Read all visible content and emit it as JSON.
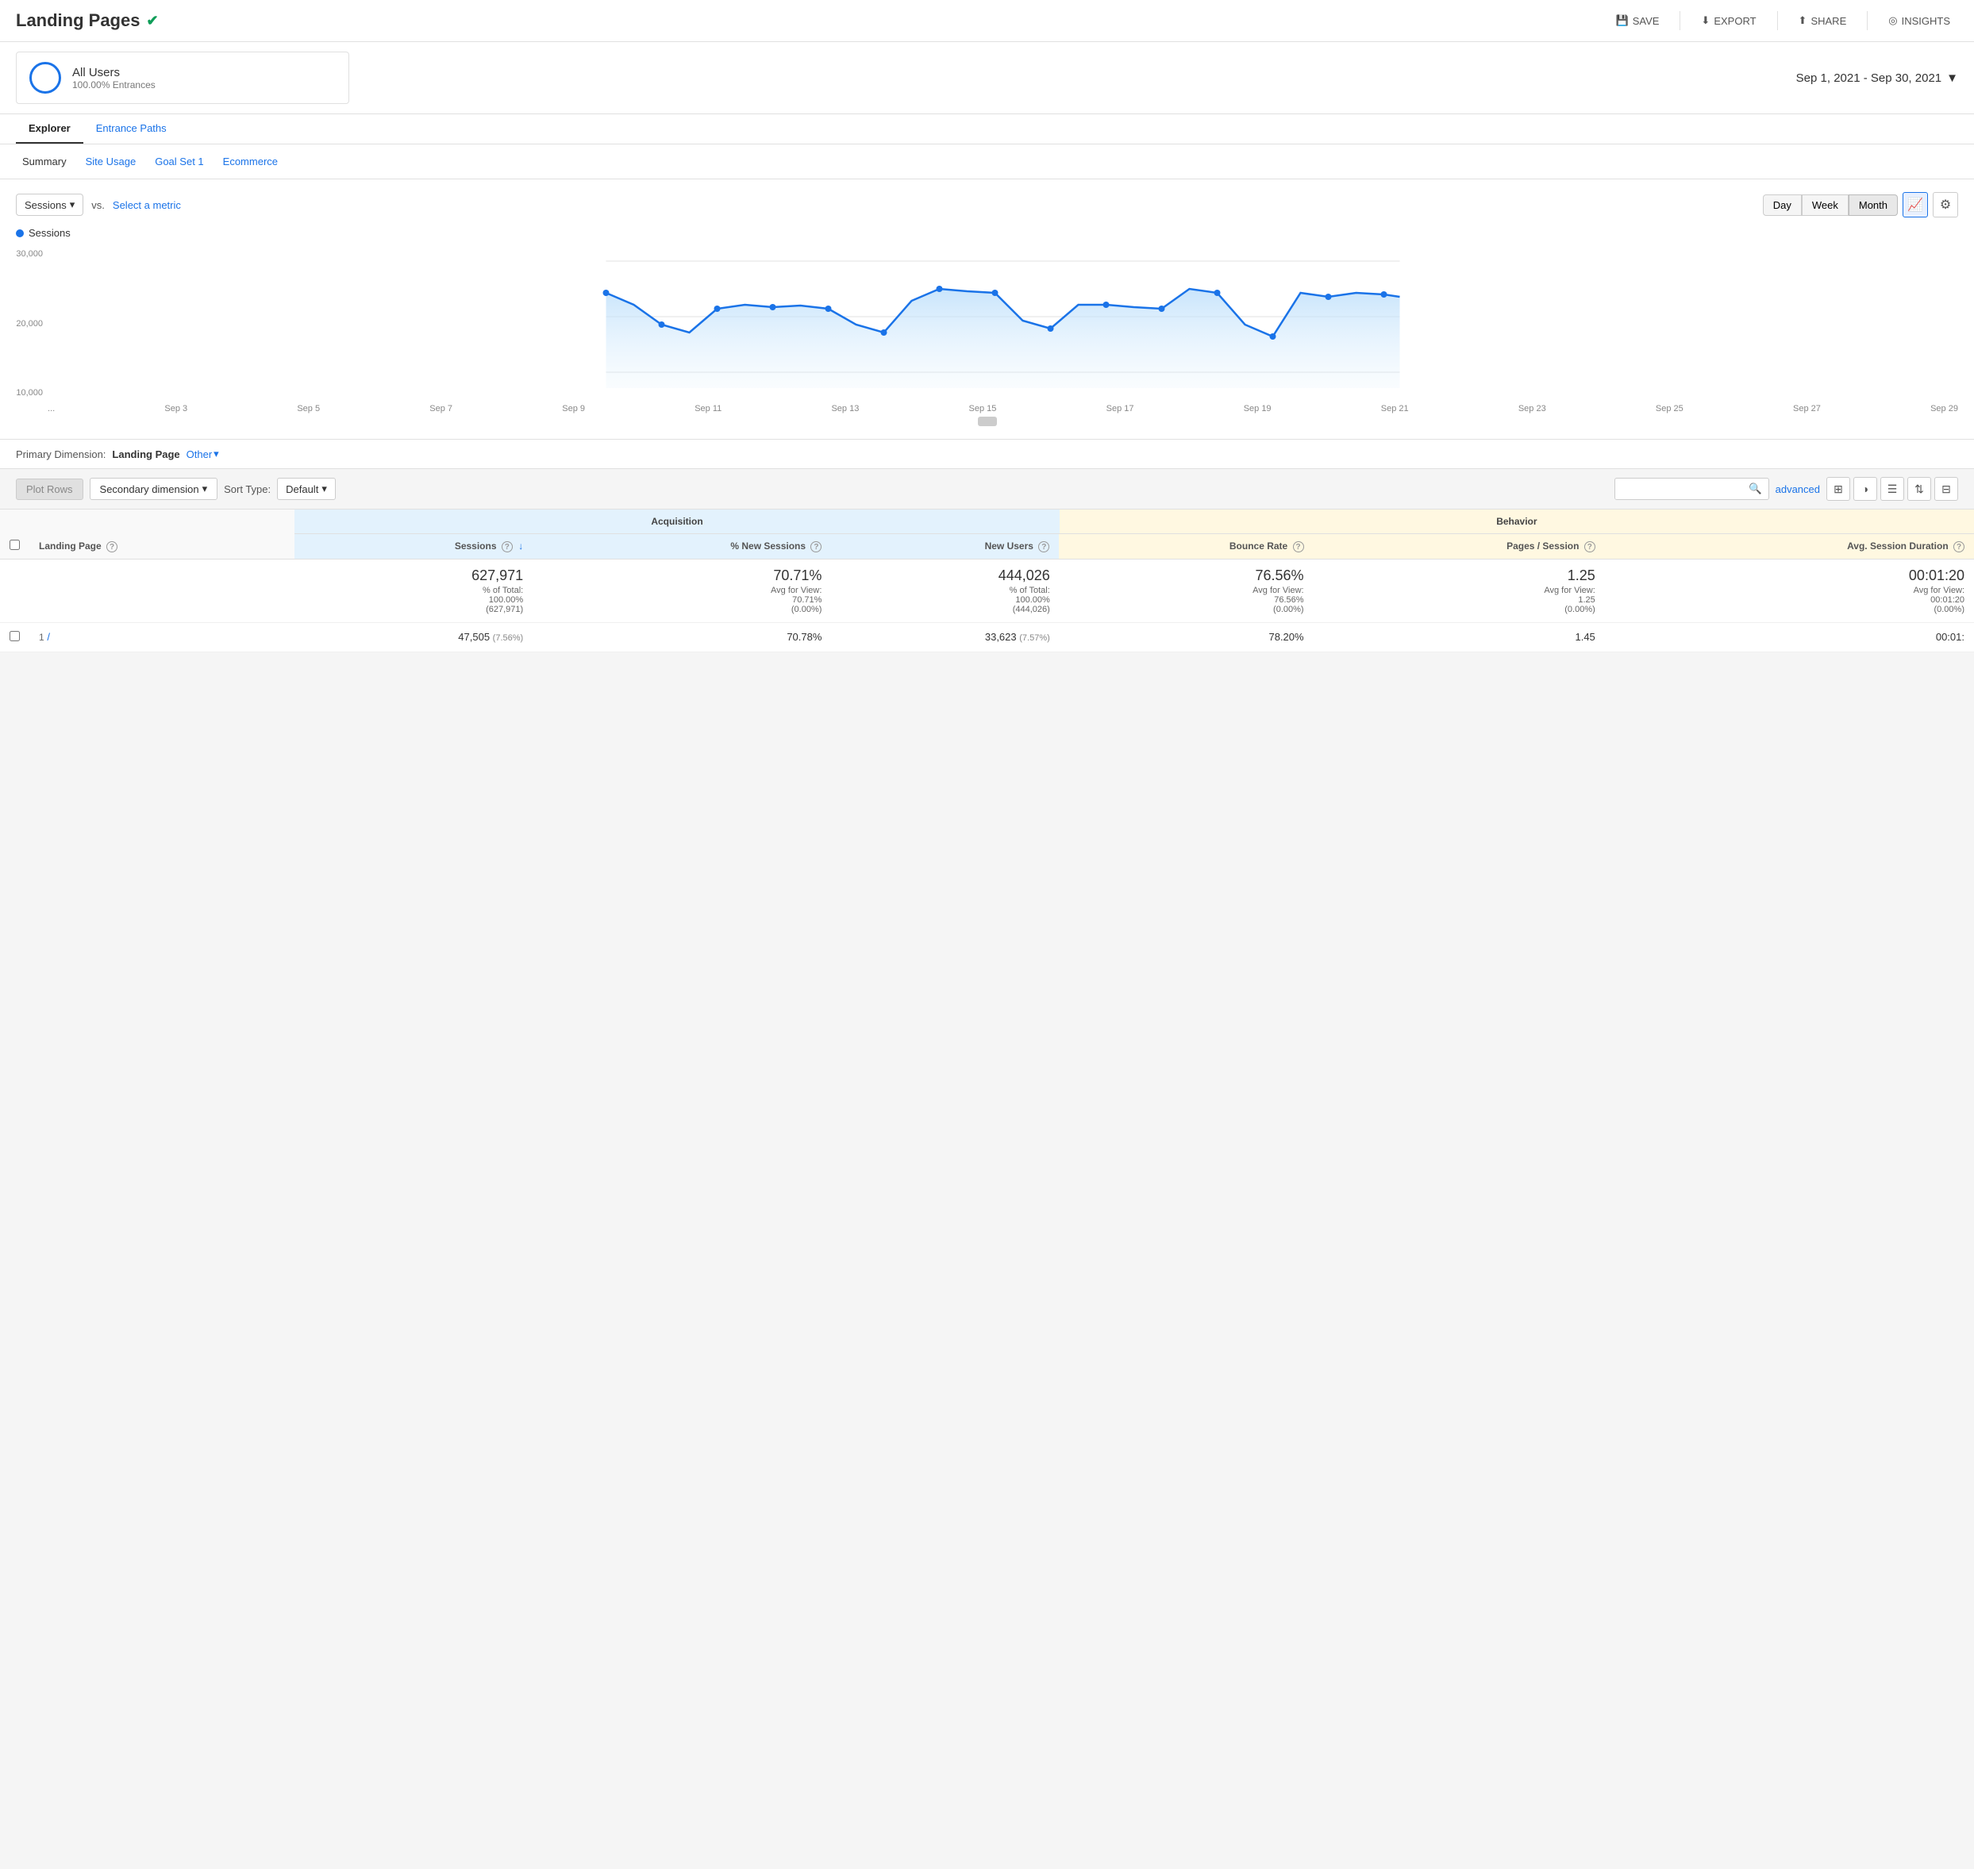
{
  "page": {
    "title": "Landing Pages",
    "verified": true
  },
  "header": {
    "save_label": "SAVE",
    "export_label": "EXPORT",
    "share_label": "SHARE",
    "insights_label": "INSIGHTS"
  },
  "segment": {
    "name": "All Users",
    "subtitle": "100.00% Entrances"
  },
  "date_range": {
    "label": "Sep 1, 2021 - Sep 30, 2021"
  },
  "tabs": {
    "main": [
      {
        "label": "Explorer",
        "active": true
      },
      {
        "label": "Entrance Paths",
        "active": false
      }
    ],
    "sub": [
      {
        "label": "Summary",
        "active": true
      },
      {
        "label": "Site Usage",
        "active": false
      },
      {
        "label": "Goal Set 1",
        "active": false
      },
      {
        "label": "Ecommerce",
        "active": false
      }
    ]
  },
  "chart": {
    "metric_label": "Sessions",
    "vs_label": "vs.",
    "select_metric_label": "Select a metric",
    "legend_label": "Sessions",
    "y_labels": [
      "30,000",
      "20,000",
      "10,000"
    ],
    "x_labels": [
      "...",
      "Sep 3",
      "Sep 5",
      "Sep 7",
      "Sep 9",
      "Sep 11",
      "Sep 13",
      "Sep 15",
      "Sep 17",
      "Sep 19",
      "Sep 21",
      "Sep 23",
      "Sep 25",
      "Sep 27",
      "Sep 29"
    ],
    "period_buttons": [
      "Day",
      "Week",
      "Month"
    ],
    "active_period": "Month"
  },
  "dimension": {
    "label": "Primary Dimension:",
    "value": "Landing Page",
    "other_label": "Other"
  },
  "table_controls": {
    "plot_rows_label": "Plot Rows",
    "secondary_dim_label": "Secondary dimension",
    "sort_type_label": "Sort Type:",
    "sort_default_label": "Default",
    "search_placeholder": "",
    "advanced_label": "advanced"
  },
  "table": {
    "col_groups": [
      {
        "label": "Acquisition",
        "colspan": 3,
        "type": "acquisition"
      },
      {
        "label": "Behavior",
        "colspan": 3,
        "type": "behavior"
      }
    ],
    "headers": [
      {
        "label": "Landing Page",
        "help": true,
        "type": "dimension"
      },
      {
        "label": "Sessions",
        "help": true,
        "sortable": true,
        "type": "acquisition"
      },
      {
        "label": "% New Sessions",
        "help": true,
        "type": "acquisition"
      },
      {
        "label": "New Users",
        "help": true,
        "type": "acquisition"
      },
      {
        "label": "Bounce Rate",
        "help": true,
        "type": "behavior"
      },
      {
        "label": "Pages / Session",
        "help": true,
        "type": "behavior"
      },
      {
        "label": "Avg. Session Duration",
        "help": true,
        "type": "behavior"
      }
    ],
    "totals": {
      "sessions": "627,971",
      "sessions_sub1": "% of Total:",
      "sessions_sub2": "100.00%",
      "sessions_sub3": "(627,971)",
      "pct_new_sessions": "70.71%",
      "pct_new_sub1": "Avg for View:",
      "pct_new_sub2": "70.71%",
      "pct_new_sub3": "(0.00%)",
      "new_users": "444,026",
      "new_users_sub1": "% of Total:",
      "new_users_sub2": "100.00%",
      "new_users_sub3": "(444,026)",
      "bounce_rate": "76.56%",
      "bounce_sub1": "Avg for View:",
      "bounce_sub2": "76.56%",
      "bounce_sub3": "(0.00%)",
      "pages_session": "1.25",
      "pages_sub1": "Avg for",
      "pages_sub2": "View:",
      "pages_sub3": "1.25",
      "pages_sub4": "(0.00%)",
      "avg_duration": "00:01:20",
      "avg_dur_sub1": "Avg for View:",
      "avg_dur_sub2": "00:01:20",
      "avg_dur_sub3": "(0.00%)"
    },
    "first_row": {
      "num": "1",
      "sessions": "47,505",
      "sessions_pct": "(7.56%)",
      "pct_new": "70.78%",
      "new_users": "33,623",
      "new_users_pct": "(7.57%)",
      "bounce_rate": "78.20%",
      "pages_session": "1.45",
      "avg_duration": "00:01:"
    }
  }
}
